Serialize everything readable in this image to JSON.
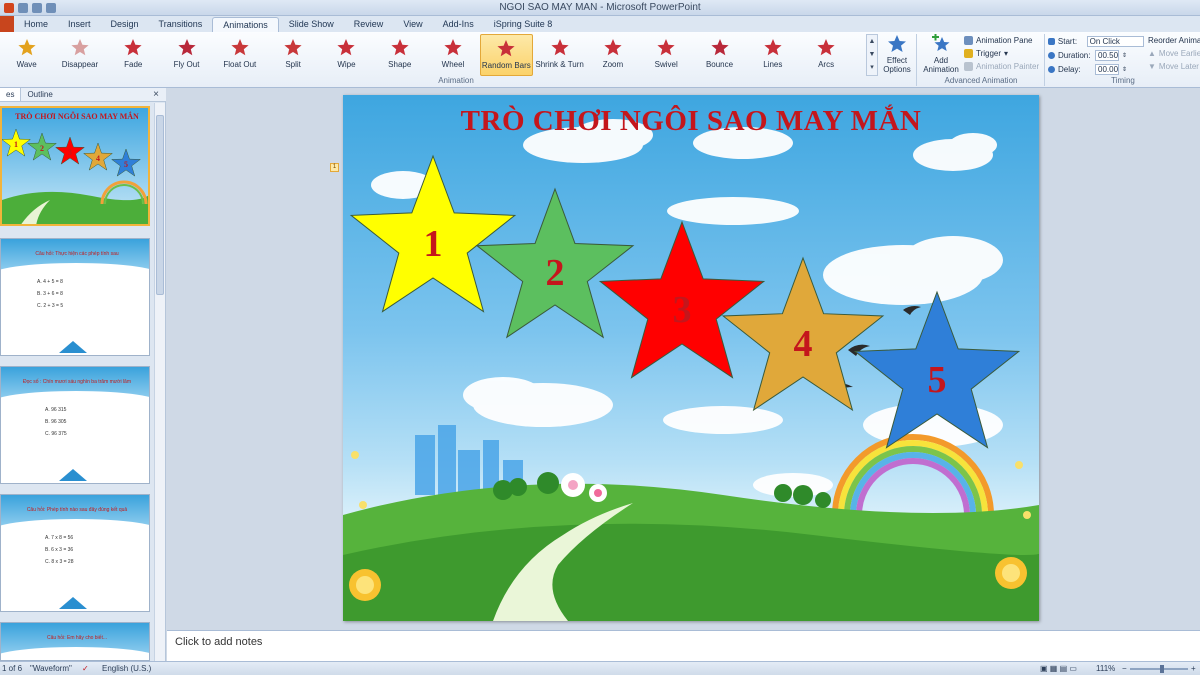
{
  "window": {
    "title": "NGOI SAO MAY MAN - Microsoft PowerPoint"
  },
  "tabs": [
    "Home",
    "Insert",
    "Design",
    "Transitions",
    "Animations",
    "Slide Show",
    "Review",
    "View",
    "Add-Ins",
    "iSpring Suite 8"
  ],
  "ribbon": {
    "animations": [
      "Wave",
      "Disappear",
      "Fade",
      "Fly Out",
      "Float Out",
      "Split",
      "Wipe",
      "Shape",
      "Wheel",
      "Random Bars",
      "Shrink & Turn",
      "Zoom",
      "Swivel",
      "Bounce",
      "Lines",
      "Arcs"
    ],
    "selected_animation": "Random Bars",
    "effect_options": "Effect Options",
    "group_animation": "Animation",
    "add_animation": "Add Animation",
    "animation_pane": "Animation Pane",
    "trigger": "Trigger",
    "animation_painter": "Animation Painter",
    "group_advanced": "Advanced Animation",
    "start_label": "Start:",
    "start_value": "On Click",
    "duration_label": "Duration:",
    "duration_value": "00.50",
    "delay_label": "Delay:",
    "delay_value": "00.00",
    "group_timing": "Timing",
    "reorder": "Reorder Animation",
    "move_earlier": "Move Earlier",
    "move_later": "Move Later"
  },
  "panel": {
    "tab_slides": "es",
    "tab_outline": "Outline",
    "close": "×",
    "thumb1_title": "TRÒ CHƠI NGÔI SAO MAY MẮN",
    "thumb2_title": "Câu hỏi: Thực hiện các phép tính sau",
    "thumb2_options": [
      "A. 4 + 5 = 8",
      "B. 3 + 6 = 8",
      "C. 2 + 3 = 5"
    ],
    "thumb3_title": "Đọc số : Chín mươi sáu nghìn ba trăm mười lăm",
    "thumb3_options": [
      "A. 96 315",
      "B. 96 305",
      "C. 96 375"
    ],
    "thumb4_title": "Câu hỏi: Phép tính nào sau đây đúng kết quả",
    "thumb4_options": [
      "A. 7 x 8 = 56",
      "B. 6 x 3 = 36",
      "C. 8 x 3 = 28"
    ],
    "thumb5_title": "Câu hỏi: Em hãy cho biết...",
    "next_label": "NEXT"
  },
  "slide": {
    "title": "TRÒ CHƠI NGÔI SAO MAY MẮN",
    "anim_marker": "1",
    "stars": [
      {
        "label": "1",
        "color": "#ffff00"
      },
      {
        "label": "2",
        "color": "#5cbf5f"
      },
      {
        "label": "3",
        "color": "#ff0000"
      },
      {
        "label": "4",
        "color": "#e0a83a"
      },
      {
        "label": "5",
        "color": "#2f7fd8"
      }
    ],
    "star_text_color": "#c4161c"
  },
  "notes": {
    "placeholder": "Click to add notes"
  },
  "status": {
    "slide_indicator": "1 of 6",
    "theme": "\"Waveform\"",
    "language": "English (U.S.)",
    "zoom": "111%"
  }
}
